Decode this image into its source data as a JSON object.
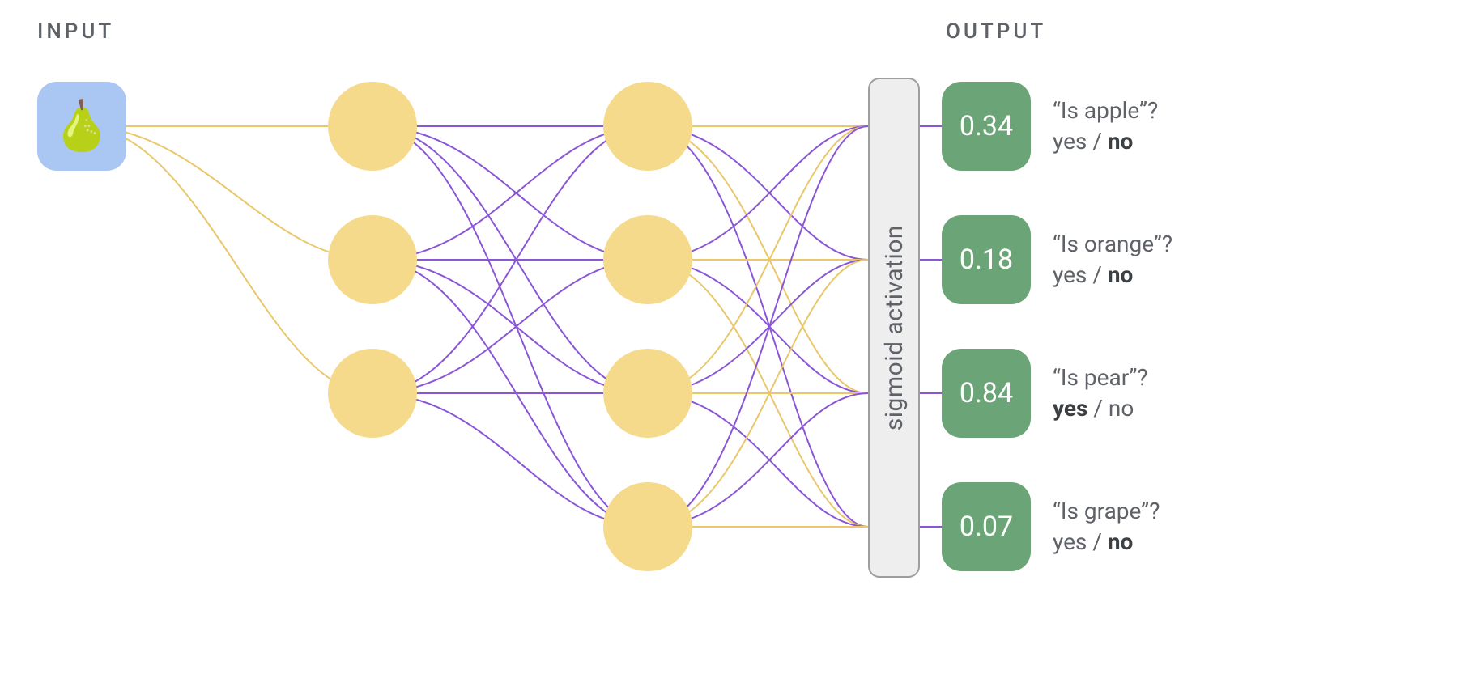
{
  "headings": {
    "input": "INPUT",
    "output": "OUTPUT"
  },
  "input": {
    "icon_name": "pear-emoji",
    "emoji": "🍐"
  },
  "hidden_layers": [
    {
      "nodes": 3
    },
    {
      "nodes": 4
    }
  ],
  "activation": {
    "label": "sigmoid activation"
  },
  "outputs": [
    {
      "value": "0.34",
      "question": "“Is apple”?",
      "yes_bold": false,
      "no_bold": true
    },
    {
      "value": "0.18",
      "question": "“Is orange”?",
      "yes_bold": false,
      "no_bold": true
    },
    {
      "value": "0.84",
      "question": "“Is pear”?",
      "yes_bold": true,
      "no_bold": false
    },
    {
      "value": "0.07",
      "question": "“Is grape”?",
      "yes_bold": false,
      "no_bold": true
    }
  ],
  "colors": {
    "node": "#f6da8c",
    "input_bg": "#aac6f2",
    "output_bg": "#6ba577",
    "edge_yellow": "#e9c76a",
    "edge_purple": "#8a56d6",
    "activation_bg": "#eeeeee",
    "activation_border": "#9e9e9e",
    "text": "#5f6368"
  }
}
